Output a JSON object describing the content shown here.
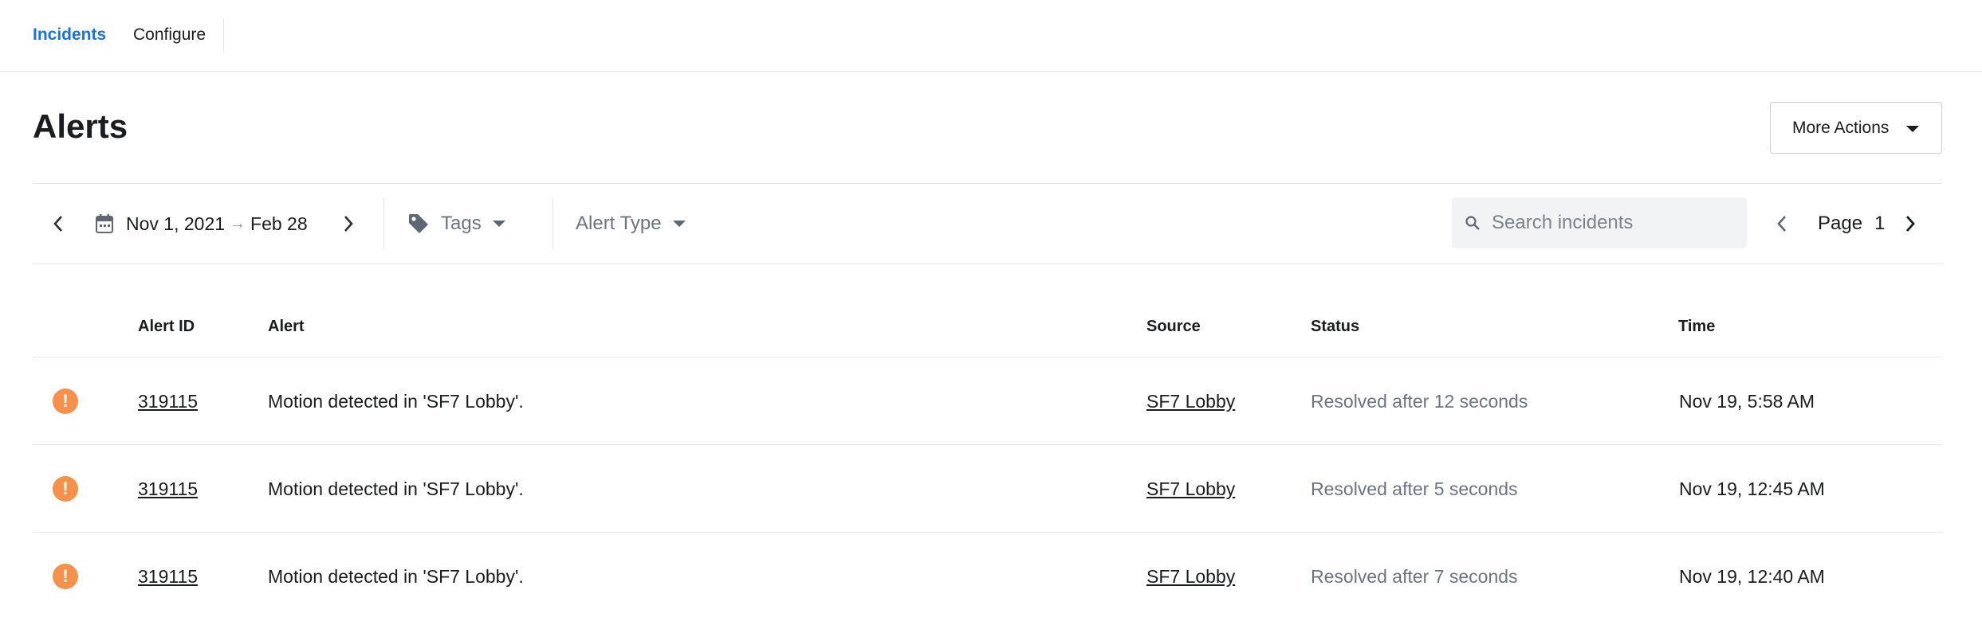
{
  "nav": {
    "tabs": [
      {
        "label": "Incidents",
        "active": true
      },
      {
        "label": "Configure",
        "active": false
      }
    ]
  },
  "page": {
    "title": "Alerts",
    "more_actions_label": "More Actions"
  },
  "filters": {
    "date_start": "Nov 1, 2021",
    "date_arrow": "→",
    "date_end": "Feb 28",
    "tags_label": "Tags",
    "alert_type_label": "Alert Type",
    "search_placeholder": "Search incidents",
    "pager_label": "Page",
    "page_number": "1"
  },
  "table": {
    "headers": {
      "alert_id": "Alert ID",
      "alert": "Alert",
      "source": "Source",
      "status": "Status",
      "time": "Time"
    },
    "rows": [
      {
        "severity_icon": "alert-icon",
        "id": "319115",
        "alert": "Motion detected in 'SF7 Lobby'.",
        "source": "SF7 Lobby",
        "status": "Resolved after 12 seconds",
        "time": "Nov 19, 5:58 AM"
      },
      {
        "severity_icon": "alert-icon",
        "id": "319115",
        "alert": "Motion detected in 'SF7 Lobby'.",
        "source": "SF7 Lobby",
        "status": "Resolved after 5 seconds",
        "time": "Nov 19, 12:45 AM"
      },
      {
        "severity_icon": "alert-icon",
        "id": "319115",
        "alert": "Motion detected in 'SF7 Lobby'.",
        "source": "SF7 Lobby",
        "status": "Resolved after 7 seconds",
        "time": "Nov 19, 12:40 AM"
      }
    ]
  },
  "colors": {
    "accent": "#1a73d9",
    "alert_orange": "#f5914a",
    "muted_text": "#6b7480",
    "border": "#e6e8eb"
  }
}
